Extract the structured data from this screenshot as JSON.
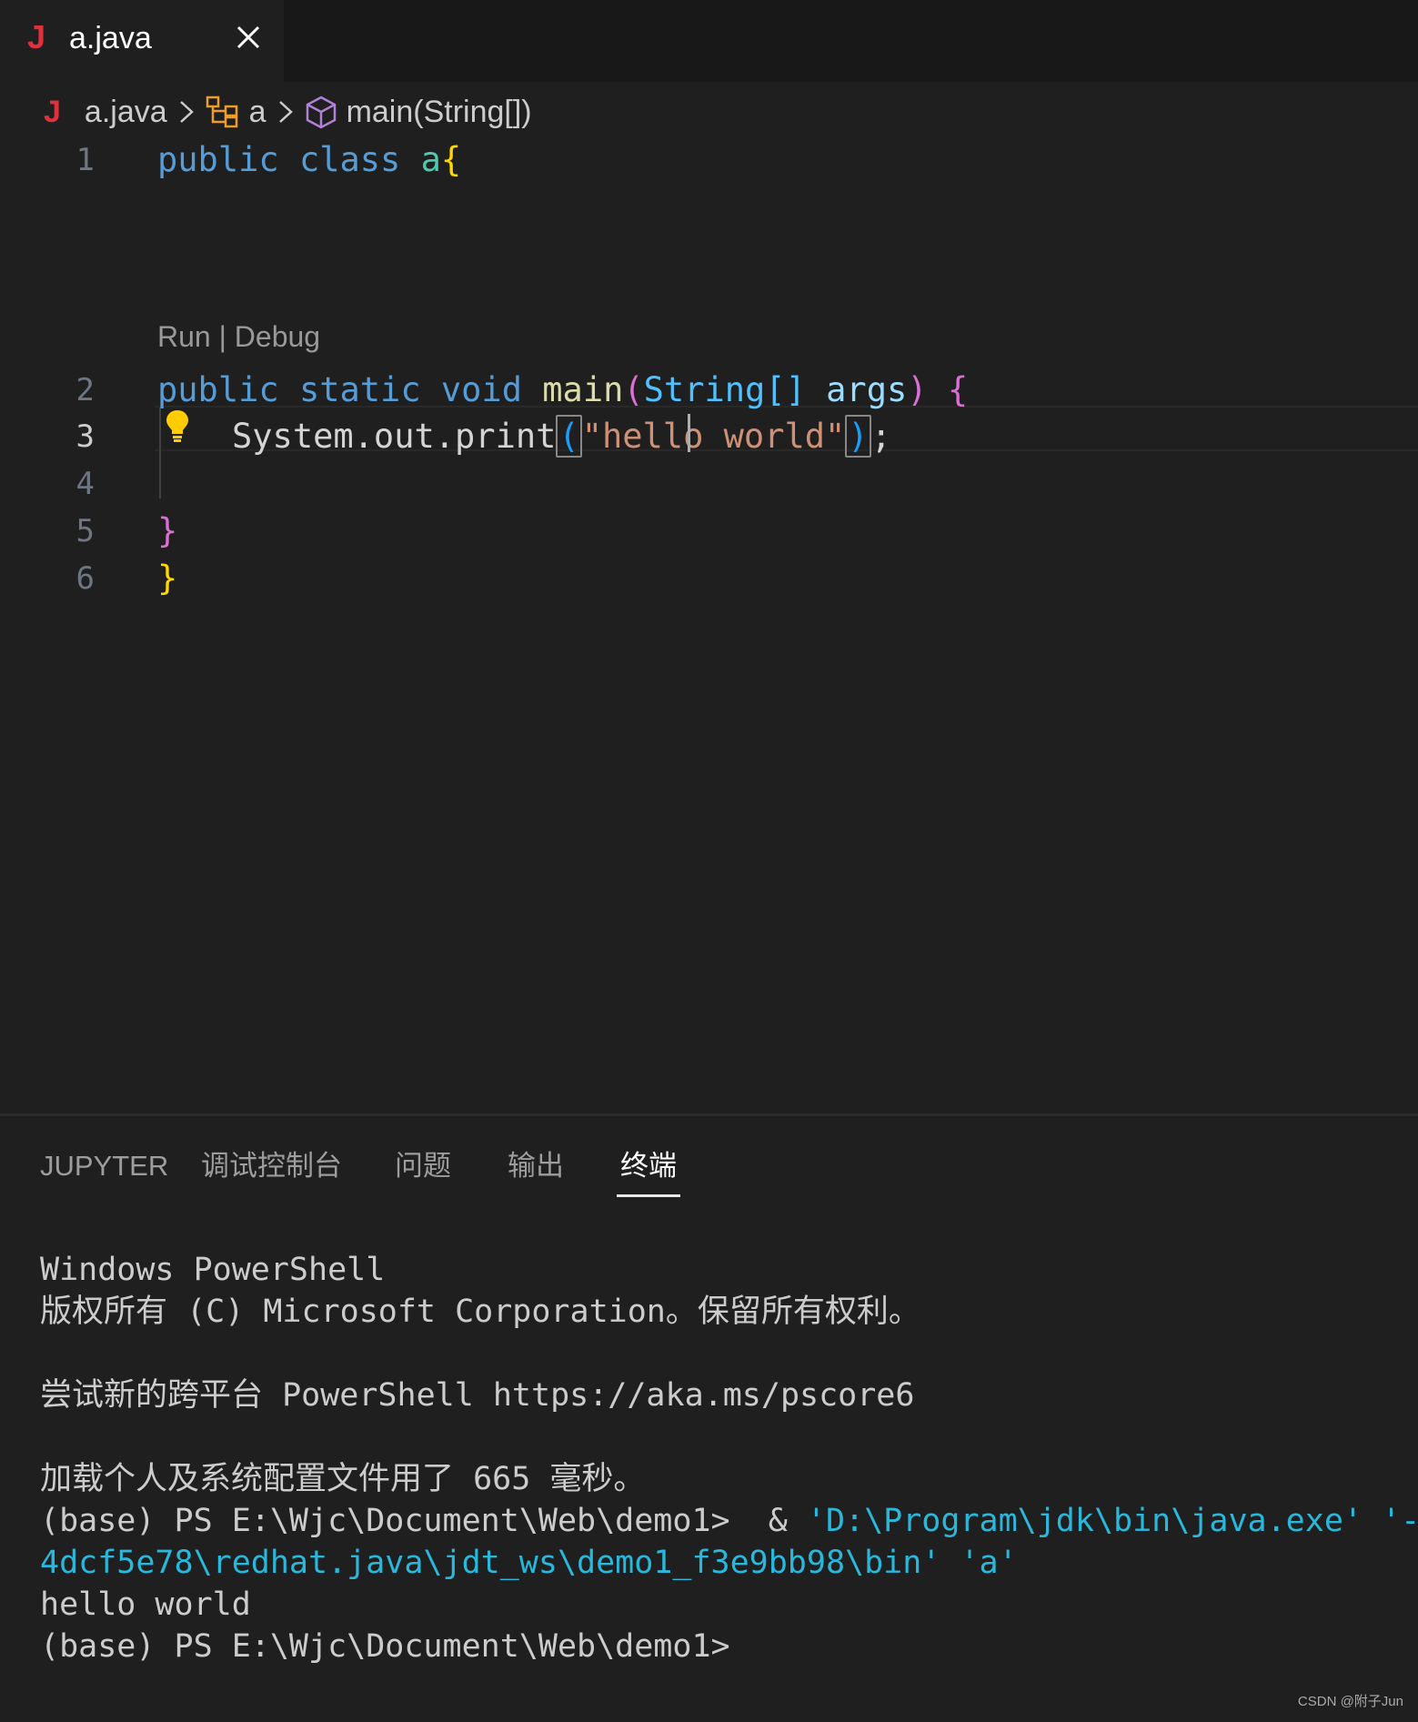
{
  "tab": {
    "icon": "J",
    "filename": "a.java"
  },
  "breadcrumb": {
    "icon": "J",
    "file": "a.java",
    "class_name": "a",
    "method": "main(String[])"
  },
  "editor": {
    "line_numbers": [
      "1",
      "2",
      "3",
      "4",
      "5",
      "6"
    ],
    "codelens": "Run | Debug",
    "line1": {
      "kw1": "public",
      "kw2": "class",
      "name": "a",
      "brace": "{"
    },
    "line2": {
      "kw1": "public",
      "kw2": "static",
      "kw3": "void",
      "fn": "main",
      "p1": "(",
      "type": "String[]",
      "arg": "args",
      "p2": ")",
      "brace": "{"
    },
    "line3": {
      "obj": "System.out.print",
      "p1": "(",
      "str1": "\"hello ",
      "str2": "world\"",
      "p2": ")",
      "semi": ";"
    },
    "line5": "}",
    "line6": "}"
  },
  "panel": {
    "tabs": [
      "JUPYTER",
      "调试控制台",
      "问题",
      "输出",
      "终端"
    ],
    "active_tab": "终端"
  },
  "terminal": {
    "l1": "Windows PowerShell",
    "l2": "版权所有 (C) Microsoft Corporation。保留所有权利。",
    "l3": "尝试新的跨平台 PowerShell https://aka.ms/pscore6",
    "l4": "加载个人及系统配置文件用了 665 毫秒。",
    "l5_prompt": "(base) PS E:\\Wjc\\Document\\Web\\demo1>  & ",
    "l5_cmd": "'D:\\Program\\jdk\\bin\\java.exe' '-cp'",
    "l6": "4dcf5e78\\redhat.java\\jdt_ws\\demo1_f3e9bb98\\bin' 'a'",
    "l7": "hello world",
    "l8": "(base) PS E:\\Wjc\\Document\\Web\\demo1>"
  },
  "watermark": "CSDN @附子Jun"
}
